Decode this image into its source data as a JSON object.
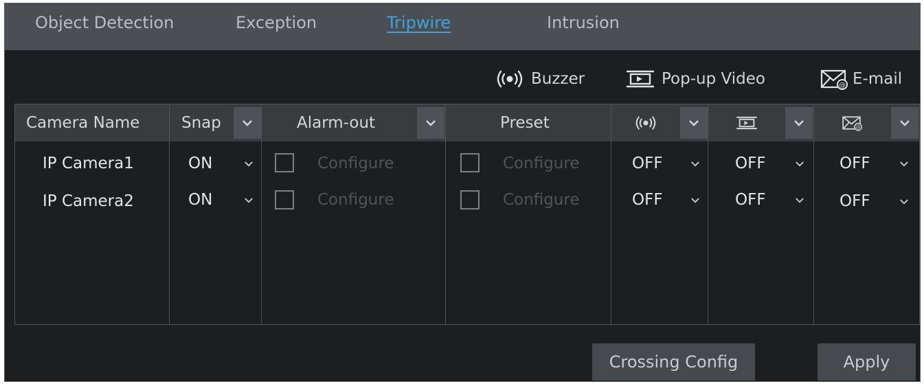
{
  "tabs": [
    {
      "label": "Object Detection",
      "active": false
    },
    {
      "label": "Exception",
      "active": false
    },
    {
      "label": "Tripwire",
      "active": true
    },
    {
      "label": "Intrusion",
      "active": false
    }
  ],
  "legend": {
    "buzzer": {
      "icon": "buzzer-icon",
      "label": "Buzzer"
    },
    "popup": {
      "icon": "popup-video-icon",
      "label": "Pop-up Video"
    },
    "email": {
      "icon": "email-icon",
      "label": "E-mail"
    }
  },
  "table": {
    "headers": {
      "camera_name": "Camera Name",
      "snap": "Snap",
      "alarm_out": "Alarm-out",
      "preset": "Preset",
      "buzzer_icon": "buzzer-icon",
      "popup_icon": "popup-video-icon",
      "email_icon": "email-icon"
    },
    "rows": [
      {
        "camera": "IP Camera1",
        "snap": "ON",
        "alarm_out": "Configure",
        "preset": "Configure",
        "buzzer": "OFF",
        "popup": "OFF",
        "email": "OFF"
      },
      {
        "camera": "IP Camera2",
        "snap": "ON",
        "alarm_out": "Configure",
        "preset": "Configure",
        "buzzer": "OFF",
        "popup": "OFF",
        "email": "OFF"
      }
    ]
  },
  "buttons": {
    "crossing_config": "Crossing Config",
    "apply": "Apply"
  },
  "colors": {
    "background": "#1d1e20",
    "tab_bar": "#4b4e53",
    "active_tab": "#3ba5e0",
    "header_row": "#393b3f",
    "button": "#46494e"
  }
}
